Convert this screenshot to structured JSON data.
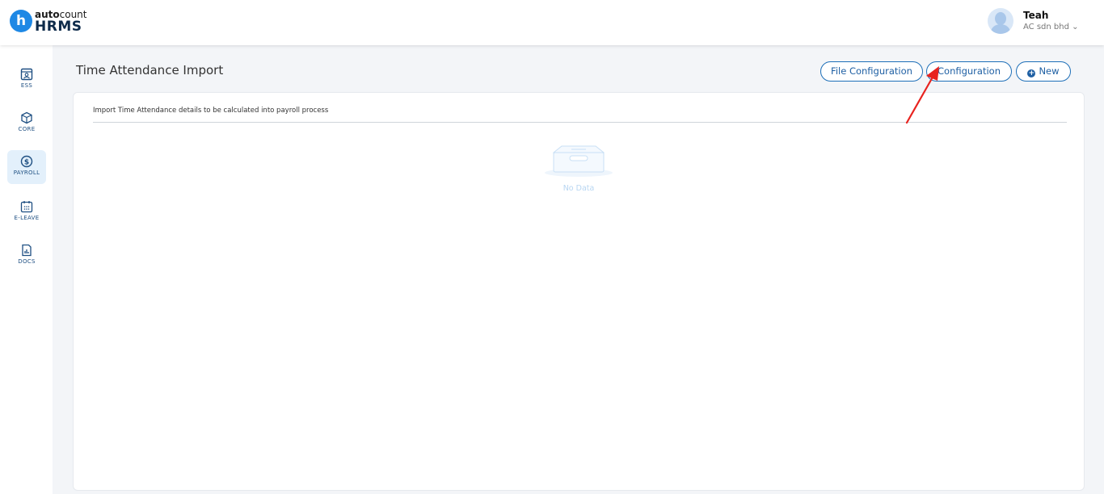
{
  "brand": {
    "logo_letter": "h",
    "name_bold": "auto",
    "name_rest": "count",
    "product": "HRMS"
  },
  "user": {
    "name": "Teah",
    "company": "AC sdn bhd"
  },
  "sidebar": {
    "items": [
      {
        "label": "ESS",
        "icon": "ess-icon"
      },
      {
        "label": "CORE",
        "icon": "core-cube-icon"
      },
      {
        "label": "PAYROLL",
        "icon": "payroll-dollar-icon",
        "active": true
      },
      {
        "label": "E-LEAVE",
        "icon": "calendar-icon"
      },
      {
        "label": "DOCS",
        "icon": "document-icon"
      }
    ]
  },
  "page": {
    "title": "Time Attendance Import",
    "description": "Import Time Attendance details to be calculated into payroll process",
    "empty_text": "No Data"
  },
  "actions": {
    "file_configuration": "File Configuration",
    "configuration": "Configuration",
    "new": "New"
  },
  "colors": {
    "accent": "#1e6fb8",
    "annotation": "#e8231f",
    "empty": "#b8d6f2"
  }
}
